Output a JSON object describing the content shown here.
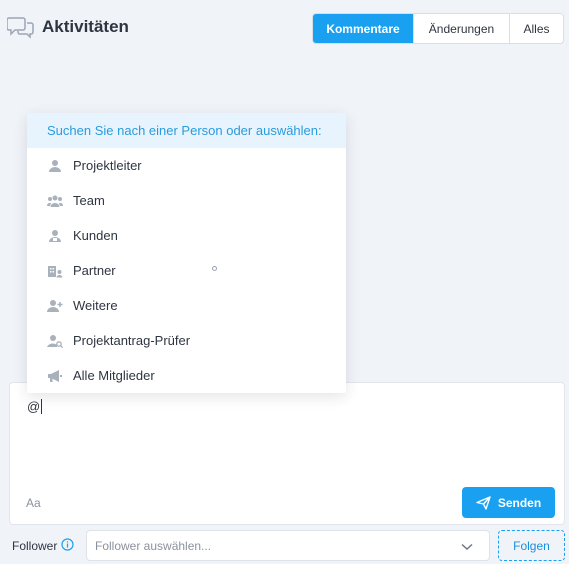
{
  "header": {
    "title": "Aktivitäten",
    "title_icon": "chat-bubbles-icon",
    "tabs": [
      {
        "label": "Kommentare",
        "active": true
      },
      {
        "label": "Änderungen",
        "active": false
      },
      {
        "label": "Alles",
        "active": false
      }
    ]
  },
  "mention_dropdown": {
    "header": "Suchen Sie nach einer Person oder auswählen:",
    "items": [
      {
        "label": "Projektleiter",
        "icon": "person-icon"
      },
      {
        "label": "Team",
        "icon": "team-icon"
      },
      {
        "label": "Kunden",
        "icon": "customer-icon"
      },
      {
        "label": "Partner",
        "icon": "building-person-icon"
      },
      {
        "label": "Weitere",
        "icon": "person-add-icon"
      },
      {
        "label": "Projektantrag-Prüfer",
        "icon": "person-search-icon"
      },
      {
        "label": "Alle Mitglieder",
        "icon": "megaphone-icon"
      }
    ]
  },
  "editor": {
    "text": "@",
    "format_hint": "Aa",
    "send_label": "Senden",
    "send_icon": "paper-plane-icon"
  },
  "follower": {
    "label": "Follower",
    "info_icon": "info-icon",
    "placeholder": "Follower auswählen...",
    "chevron_icon": "chevron-down-icon",
    "follow_label": "Folgen"
  },
  "colors": {
    "accent": "#1aa0f0",
    "background": "#f0f3f8",
    "dropdown_header_bg": "#e8f4fd",
    "icon_gray": "#a9b1bb"
  }
}
